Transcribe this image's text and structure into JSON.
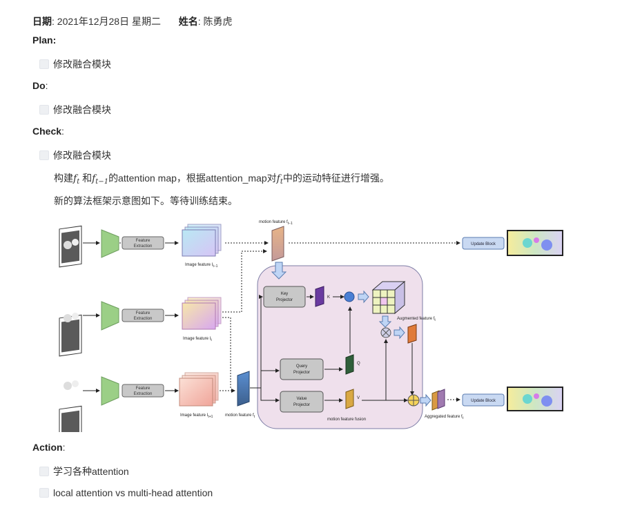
{
  "header": {
    "date_label": "日期",
    "date_value": ": 2021年12月28日 星期二",
    "name_label": "姓名",
    "name_value": ": 陈勇虎"
  },
  "sections": {
    "plan": {
      "label": "Plan",
      "colon": ":",
      "tasks": [
        "修改融合模块"
      ]
    },
    "do": {
      "label": "Do",
      "colon": ":",
      "tasks": [
        "修改融合模块"
      ]
    },
    "check": {
      "label": "Check",
      "colon": ":",
      "tasks": [
        "修改融合模块"
      ]
    },
    "action": {
      "label": "Action",
      "colon": ":",
      "tasks": [
        "学习各种attention",
        "local attention vs multi-head attention"
      ]
    }
  },
  "body": {
    "para1": {
      "p1": "构建",
      "f_t": "f",
      "t": "t",
      "p2": " 和",
      "f_t1": "f",
      "t1": "t−1",
      "p3": "的attention map，根据attention_map对",
      "p4": "中的运动特征进行增强。"
    },
    "para2": "新的算法框架示意图如下。等待训练结束。"
  },
  "diagram": {
    "motion_feature_top": "motion feature f",
    "motion_feature_top_sub": "t−1",
    "feature_extraction": [
      "Feature",
      "Extraction"
    ],
    "image_feature_1": "Image feature I",
    "image_feature_1_sub": "t−1",
    "image_feature_2": "Image feature I",
    "image_feature_2_sub": "t",
    "image_feature_3": "Image feature I",
    "image_feature_3_sub": "t+1",
    "motion_feature_bottom": "motion feature f",
    "motion_feature_bottom_sub": "t",
    "key_projector": [
      "Key",
      "Projector"
    ],
    "query_projector": [
      "Query",
      "Projector"
    ],
    "value_projector": [
      "Value",
      "Projector"
    ],
    "k": "K",
    "q": "Q",
    "v": "V",
    "augmented_feature": "Augmented feature f",
    "augmented_feature_sub": "t",
    "motion_feature_fusion": "motion feature fusion",
    "aggregated_feature": "Aggregated feature f",
    "aggregated_feature_sub": "t",
    "update_block": "Update Block",
    "colors": {
      "green": "#9bcf86",
      "box": "#c8c8c8",
      "fusion_bg": "#efe0ec",
      "update": "#c9d9f2"
    }
  }
}
